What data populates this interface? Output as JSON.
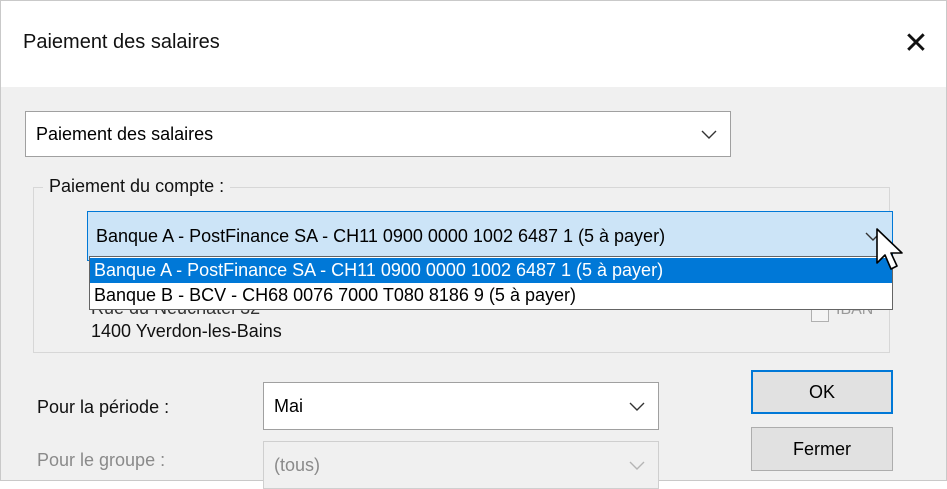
{
  "window": {
    "title": "Paiement des salaires",
    "close_glyph": "✕"
  },
  "payment_type": {
    "value": "Paiement des salaires"
  },
  "account_group": {
    "label": "Paiement du compte :",
    "selected": "Banque A - PostFinance SA - CH11 0900 0000 1002 6487 1 (5 à payer)",
    "options": [
      "Banque A - PostFinance SA - CH11 0900 0000 1002 6487 1 (5 à payer)",
      "Banque B - BCV - CH68 0076 7000 T080 8186 9 (5 à payer)"
    ],
    "address_partial": "Rue du Neuchâtel 32",
    "address_city": "1400 Yverdon-les-Bains",
    "iban_label": "IBAN"
  },
  "period": {
    "label": "Pour la période :",
    "value": "Mai"
  },
  "group": {
    "label": "Pour le groupe :",
    "value": "(tous)"
  },
  "buttons": {
    "ok": "OK",
    "close": "Fermer"
  },
  "colors": {
    "accent": "#0078d7",
    "highlight": "#cce4f7"
  }
}
